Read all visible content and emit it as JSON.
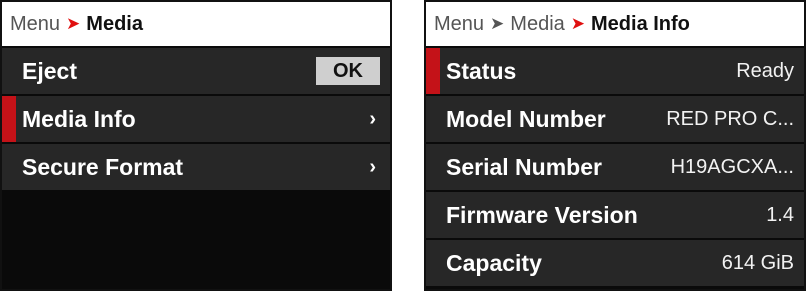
{
  "left_panel": {
    "breadcrumb": {
      "root": "Menu",
      "current": "Media"
    },
    "items": [
      {
        "label": "Eject",
        "action": "OK"
      },
      {
        "label": "Media Info",
        "chevron": "›",
        "selected": true
      },
      {
        "label": "Secure Format",
        "chevron": "›"
      }
    ]
  },
  "right_panel": {
    "breadcrumb": {
      "root": "Menu",
      "middle": "Media",
      "current": "Media Info"
    },
    "items": [
      {
        "label": "Status",
        "value": "Ready",
        "selected": true
      },
      {
        "label": "Model Number",
        "value": "RED PRO C..."
      },
      {
        "label": "Serial Number",
        "value": "H19AGCXA..."
      },
      {
        "label": "Firmware Version",
        "value": "1.4"
      },
      {
        "label": "Capacity",
        "value": "614 GiB"
      }
    ]
  },
  "colors": {
    "accent": "#c41218",
    "row_bg": "#272727",
    "panel_bg": "#0a0a0a",
    "header_bg": "#ffffff"
  },
  "icons": {
    "separator": "chevron-right-icon",
    "row_chevron": "chevron-right-icon"
  }
}
